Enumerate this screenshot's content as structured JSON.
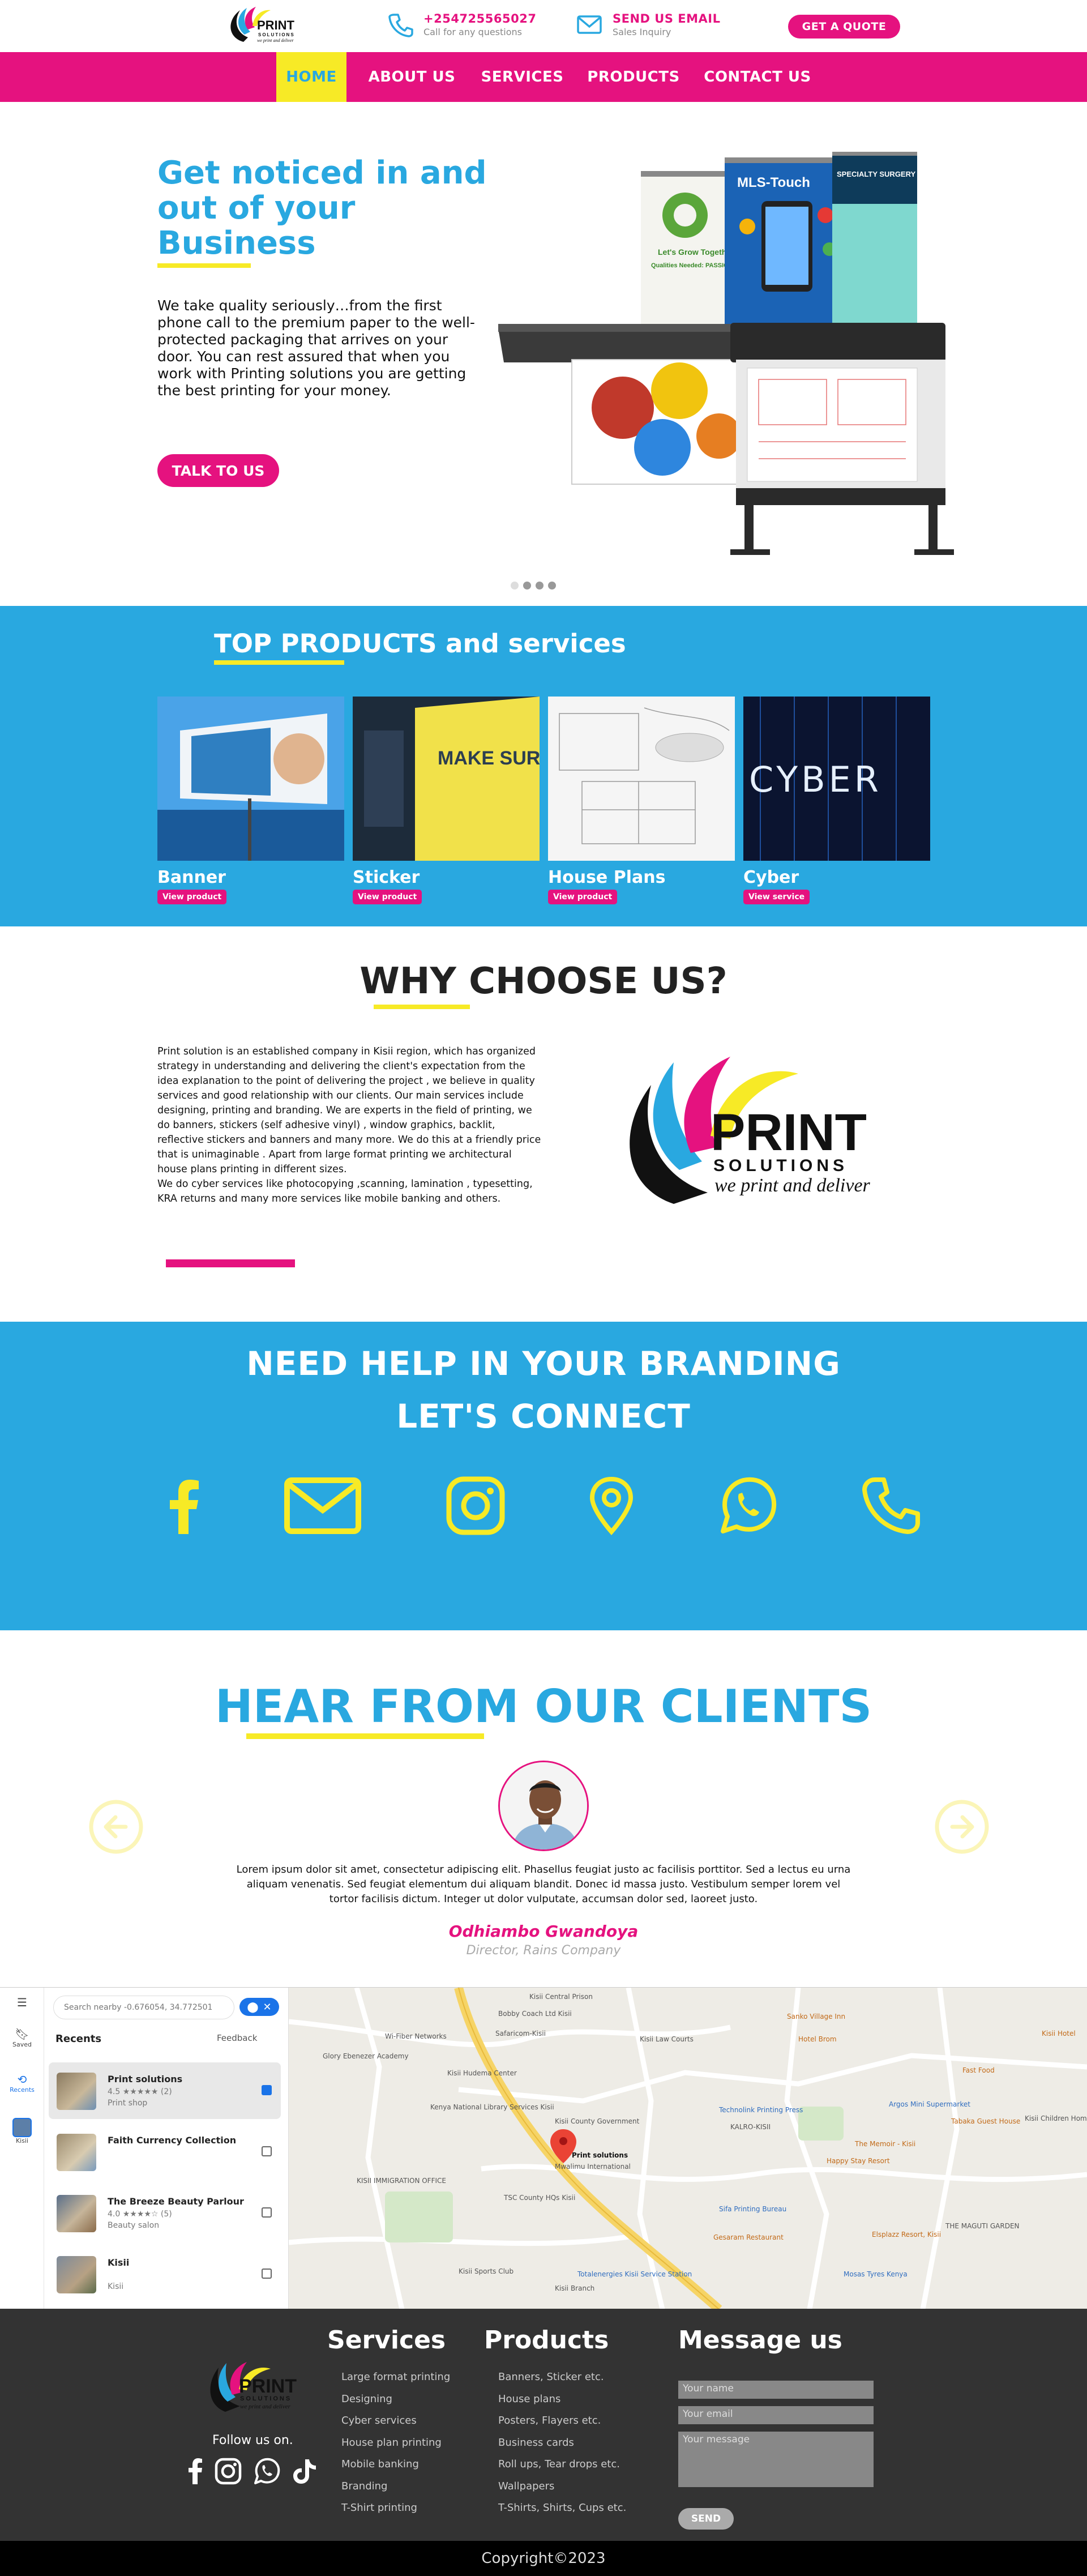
{
  "header": {
    "phone": "+254725565027",
    "phone_sub": "Call for any questions",
    "email_label": "SEND US EMAIL",
    "email_sub": "Sales Inquiry",
    "quote_label": "GET A QUOTE",
    "logo_word": "PRINT",
    "logo_sub": "SOLUTIONS",
    "logo_tag": "we print and deliver"
  },
  "nav": {
    "items": [
      "HOME",
      "ABOUT US",
      "SERVICES",
      "PRODUCTS",
      "CONTACT US"
    ],
    "active": "HOME"
  },
  "hero": {
    "title": "Get noticed in and out of your Business",
    "text": "We take quality seriously…from the first phone call to the premium paper to the well-protected packaging that arrives on your door. You can rest assured that when you work with Printing solutions you are getting the best printing for your money.",
    "cta": "TALK TO US",
    "banner_left_text": "Let's Grow Together!",
    "banner_left_sub": "Qualities Needed: PASSION",
    "banner_mid_text": "MLS-Touch",
    "banner_right_text": "SPECIALTY SURGERY CENTER"
  },
  "products": {
    "title": "TOP PRODUCTS and services",
    "items": [
      {
        "name": "Banner",
        "button": "View product"
      },
      {
        "name": "Sticker",
        "button": "View product"
      },
      {
        "name": "House Plans",
        "button": "View product"
      },
      {
        "name": "Cyber",
        "button": "View service"
      }
    ],
    "sticker_art": "MAKE SURE GREAT A",
    "cyber_art": "CYBER"
  },
  "why": {
    "title": "WHY CHOOSE US?",
    "text": "Print solution is an established company in Kisii region, which has organized strategy in understanding and delivering the client's expectation from the idea explanation to the point of delivering the project  , we believe in quality services and good relationship with our clients. Our main services include designing, printing and branding. We are experts in the field of printing, we do banners, stickers (self adhesive vinyl) , window graphics, backlit, reflective stickers and banners and many more. We do this at a friendly price that is unimaginable . Apart from large format printing we architectural house plans printing in different sizes.",
    "text2": "We do cyber services like photocopying ,scanning, lamination , typesetting, KRA returns and many more services like mobile banking and others.",
    "logo_word": "PRINT",
    "logo_sub": "SOLUTIONS",
    "logo_tag": "we print and deliver"
  },
  "connect": {
    "line1": "NEED HELP IN YOUR BRANDING",
    "line2": "LET'S CONNECT",
    "icons": [
      "facebook-icon",
      "mail-icon",
      "instagram-icon",
      "location-pin-icon",
      "whatsapp-icon",
      "phone-icon"
    ]
  },
  "testimonials": {
    "title": "HEAR FROM OUR CLIENTS",
    "quote": "Lorem ipsum dolor sit amet, consectetur adipiscing elit. Phasellus feugiat justo ac facilisis porttitor. Sed a lectus eu urna aliquam venenatis. Sed feugiat elementum dui aliquam blandit. Donec id massa justo. Vestibulum semper lorem vel tortor facilisis dictum. Integer ut dolor vulputate, accumsan dolor sed, laoreet justo.",
    "name": "Odhiambo Gwandoya",
    "role": "Director, Rains Company"
  },
  "map": {
    "rail": [
      "Saved",
      "Recents",
      "Kisii"
    ],
    "search_value": "Search nearby -0.676054, 34.772501",
    "recents_label": "Recents",
    "feedback_label": "Feedback",
    "recents": [
      {
        "name": "Print solutions",
        "rating": "4.5 ★★★★★ (2)",
        "type": "Print shop",
        "checked": true
      },
      {
        "name": "Faith Currency Collection",
        "rating": "",
        "type": "",
        "checked": false
      },
      {
        "name": "The Breeze Beauty Parlour",
        "rating": "4.0 ★★★★☆ (5)",
        "type": "Beauty salon",
        "checked": false
      },
      {
        "name": "Kisii",
        "rating": "",
        "type": "Kisii",
        "checked": false
      }
    ],
    "labels": [
      "Kisii Central Prison",
      "Bobby Coach Ltd Kisii",
      "Safaricom-Kisii",
      "Kisii Law Courts",
      "Sanko Village Inn",
      "Hotel Brom",
      "Fast Food",
      "Kisii Hotel",
      "Wi-Fiber Networks",
      "Glory Ebenezer Academy",
      "Kisii Hudema Center",
      "Technolink Printing Press",
      "Kenya National Library Services Kisii",
      "Kisii County Government",
      "KALRO-KISII",
      "Argos Mini Supermarket",
      "Tabaka Guest House",
      "The Memoir - Kisii",
      "Happy Stay Resort",
      "Kisii Children Home",
      "Print solutions",
      "Mwalimu International",
      "KISII IMMIGRATION OFFICE",
      "TSC County HQs Kisii",
      "Sifa Printing Bureau",
      "Gesaram Restaurant",
      "Elsplazz Resort, Kisii",
      "THE MAGUTI GARDEN",
      "Kisii Sports Club",
      "Totalenergies Kisii Service Station",
      "Mosas Tyres Kenya",
      "Kisii Branch"
    ]
  },
  "footer": {
    "follow": "Follow us on.",
    "services_h": "Services",
    "services": [
      "Large format printing",
      "Designing",
      "Cyber services",
      "House plan printing",
      "Mobile banking",
      "Branding",
      "T-Shirt printing"
    ],
    "products_h": "Products",
    "products": [
      "Banners, Sticker etc.",
      "House plans",
      "Posters, Flayers etc.",
      "Business cards",
      "Roll ups, Tear drops etc.",
      "Wallpapers",
      "T-Shirts, Shirts, Cups etc."
    ],
    "message_h": "Message us",
    "name_placeholder": "Your name",
    "email_placeholder": "Your email",
    "message_placeholder": "Your message",
    "send": "SEND",
    "copyright": "Copyright©2023"
  },
  "colors": {
    "magenta": "#e5127f",
    "blue": "#29a8e0",
    "yellow": "#f7ea26",
    "dark": "#333333"
  }
}
